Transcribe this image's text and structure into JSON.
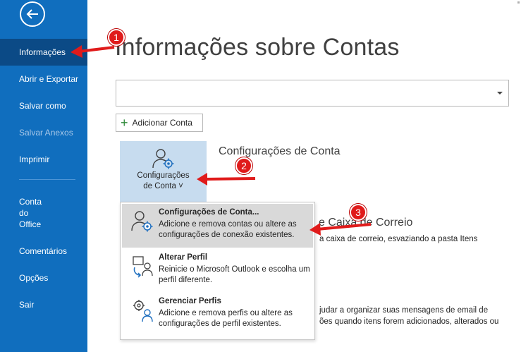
{
  "nav": {
    "items": [
      {
        "label": "Informações",
        "active": true
      },
      {
        "label": "Abrir e Exportar"
      },
      {
        "label": "Salvar como"
      },
      {
        "label": "Salvar Anexos",
        "disabled": true
      },
      {
        "label": "Imprimir"
      },
      {
        "label_lines": [
          "Conta",
          "do",
          "Office"
        ]
      },
      {
        "label": "Comentários"
      },
      {
        "label": "Opções"
      },
      {
        "label": "Sair"
      }
    ]
  },
  "main": {
    "title": "Informações sobre Contas",
    "add_account_label": "Adicionar Conta",
    "settings_tile": {
      "label_line1": "Configurações",
      "label_line2": "de Conta ˅"
    },
    "account_settings_title": "Configurações de Conta",
    "mailbox_title": "e Caixa de Correio",
    "mailbox_text": "a caixa de correio, esvaziando a pasta Itens",
    "rules_text_line1": "judar a organizar suas mensagens de email de",
    "rules_text_line2": "ões quando itens forem adicionados, alterados ou"
  },
  "dropdown": {
    "items": [
      {
        "title": "Configurações de Conta...",
        "desc": "Adicione e remova contas ou altere as configurações de conexão existentes.",
        "icon": "account-settings-icon"
      },
      {
        "title": "Alterar Perfil",
        "desc": "Reinicie o Microsoft Outlook e escolha um perfil diferente.",
        "icon": "change-profile-icon"
      },
      {
        "title": "Gerenciar Perfis",
        "desc": "Adicione e remova perfis ou altere as configurações de perfil existentes.",
        "icon": "manage-profiles-icon"
      }
    ]
  },
  "annotations": {
    "badges": [
      "1",
      "2",
      "3"
    ],
    "color": "#e01b1b"
  },
  "colors": {
    "nav_bg": "#106ebe",
    "nav_active": "#0b4a86",
    "tile_bg": "#c7dcef",
    "hover_bg": "#d9d9d9"
  }
}
